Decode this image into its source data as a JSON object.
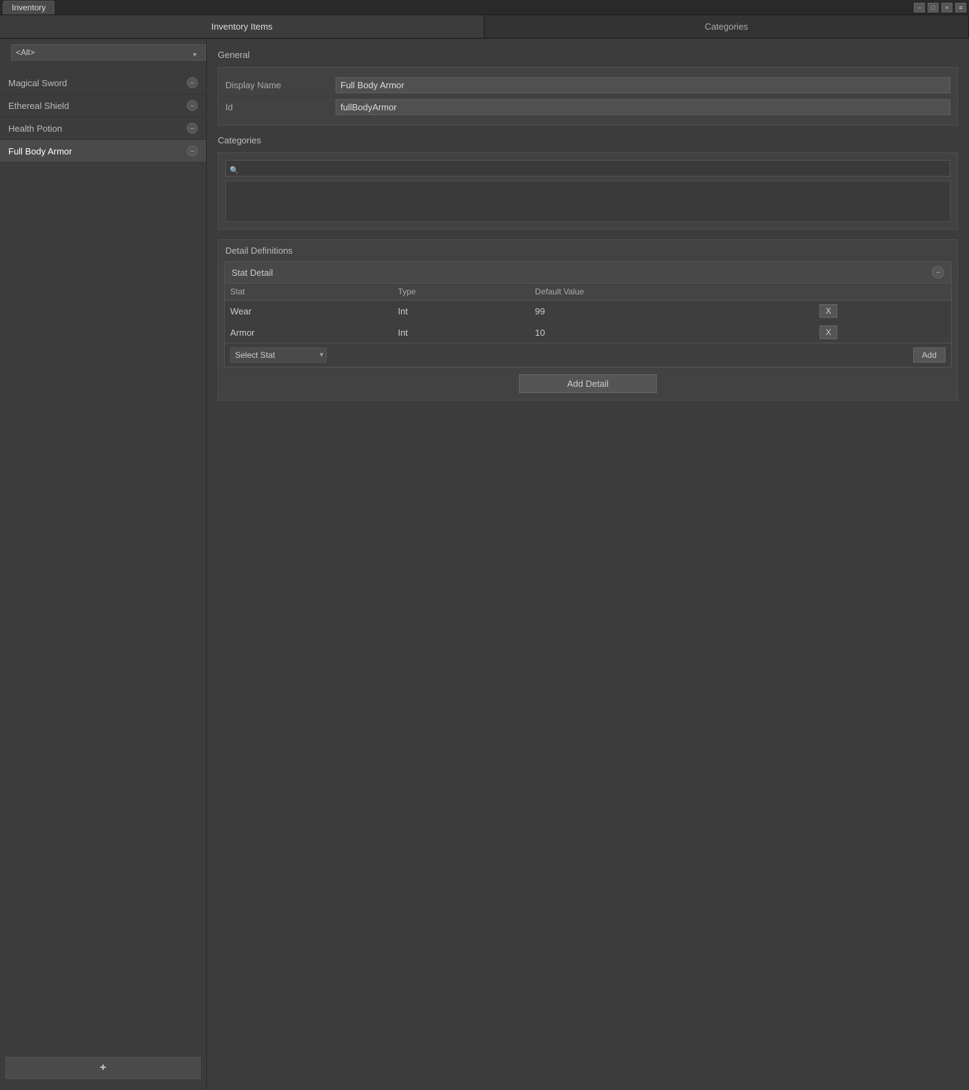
{
  "titleBar": {
    "title": "Inventory",
    "controls": {
      "minimize": "–",
      "maximize": "□",
      "close": "×",
      "menu": "≡"
    }
  },
  "tabs": [
    {
      "id": "inventory-items",
      "label": "Inventory Items",
      "active": true
    },
    {
      "id": "categories",
      "label": "Categories",
      "active": false
    }
  ],
  "sidebar": {
    "filter": {
      "value": "<All>",
      "options": [
        "<All>"
      ]
    },
    "items": [
      {
        "name": "Magical Sword",
        "selected": false
      },
      {
        "name": "Ethereal Shield",
        "selected": false
      },
      {
        "name": "Health Potion",
        "selected": false
      },
      {
        "name": "Full Body Armor",
        "selected": true
      }
    ],
    "addButton": "+"
  },
  "mainPanel": {
    "sections": {
      "general": {
        "title": "General",
        "fields": [
          {
            "label": "Display Name",
            "value": "Full Body Armor"
          },
          {
            "label": "Id",
            "value": "fullBodyArmor"
          }
        ]
      },
      "categories": {
        "title": "Categories",
        "searchPlaceholder": "",
        "items": []
      },
      "detailDefinitions": {
        "title": "Detail Definitions",
        "blocks": [
          {
            "title": "Stat Detail",
            "columns": [
              "Stat",
              "Type",
              "Default Value"
            ],
            "rows": [
              {
                "stat": "Wear",
                "type": "Int",
                "defaultValue": "99"
              },
              {
                "stat": "Armor",
                "type": "Int",
                "defaultValue": "10"
              }
            ],
            "selectStat": {
              "placeholder": "Select Stat",
              "options": [
                "Select Stat"
              ]
            },
            "addButton": "Add"
          }
        ],
        "addDetailButton": "Add Detail"
      }
    }
  }
}
